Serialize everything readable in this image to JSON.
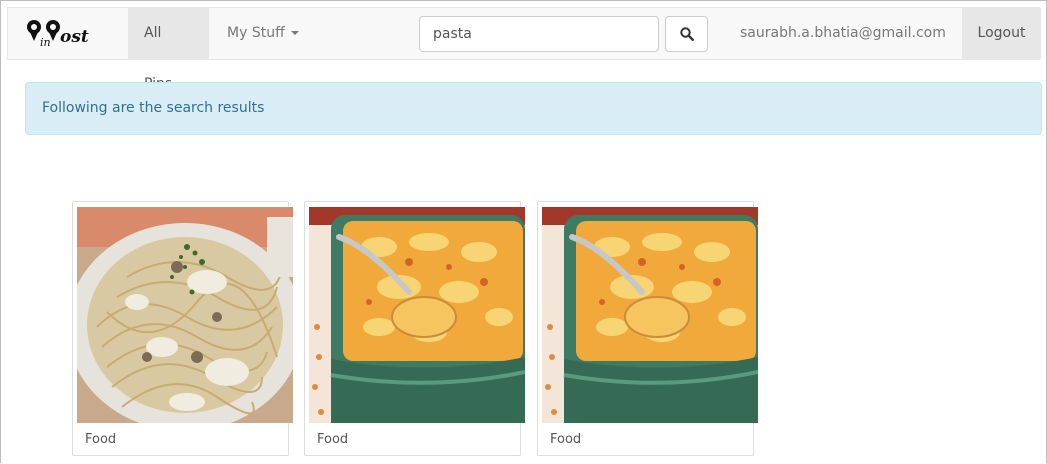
{
  "brand": {
    "logo_text": "PinPost"
  },
  "nav": {
    "all_pins": "All Pins",
    "my_stuff": "My Stuff",
    "search_value": "pasta",
    "user_email": "saurabh.a.bhatia@gmail.com",
    "logout": "Logout"
  },
  "alert": {
    "message": "Following are the search results"
  },
  "results": [
    {
      "category": "Food",
      "image": "pasta-photo"
    },
    {
      "category": "Food",
      "image": "casserole-photo"
    },
    {
      "category": "Food",
      "image": "casserole-photo"
    }
  ],
  "colors": {
    "navbar_bg": "#f8f8f8",
    "active_nav_bg": "#e7e7e7",
    "alert_bg": "#d9edf7",
    "alert_text": "#31708f"
  }
}
